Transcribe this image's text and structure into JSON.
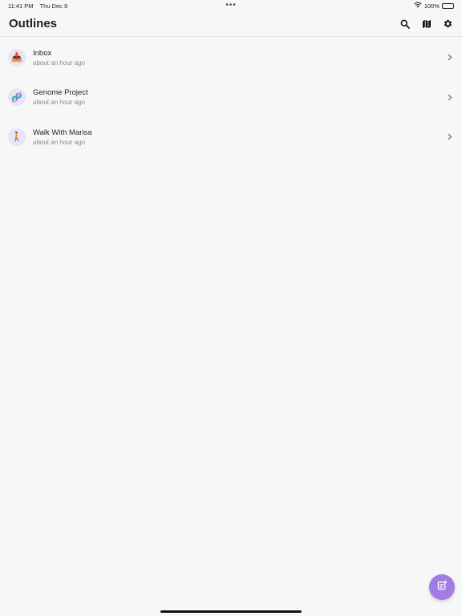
{
  "status_bar": {
    "time": "11:41 PM",
    "date": "Thu Dec 9",
    "center_dots": "•••",
    "battery_percent": "100%",
    "wifi_icon": "wifi-icon",
    "battery_icon": "battery-icon"
  },
  "header": {
    "title": "Outlines",
    "actions": [
      "search-icon",
      "map-icon",
      "gear-icon"
    ]
  },
  "outlines": [
    {
      "title": "Inbox",
      "subtitle": "about an hour ago",
      "icon": "inbox-tray-icon",
      "glyph": "📥"
    },
    {
      "title": "Genome Project",
      "subtitle": "about an hour ago",
      "icon": "dna-icon",
      "glyph": "🧬"
    },
    {
      "title": "Walk With Marisa",
      "subtitle": "about an hour ago",
      "icon": "walking-person-icon",
      "glyph": "🚶"
    }
  ],
  "fab": {
    "icon": "new-note-icon",
    "color": "#a27be3"
  },
  "colors": {
    "background": "#f7f7f8",
    "avatar_bg": "#e9e3f5",
    "accent": "#a27be3"
  }
}
